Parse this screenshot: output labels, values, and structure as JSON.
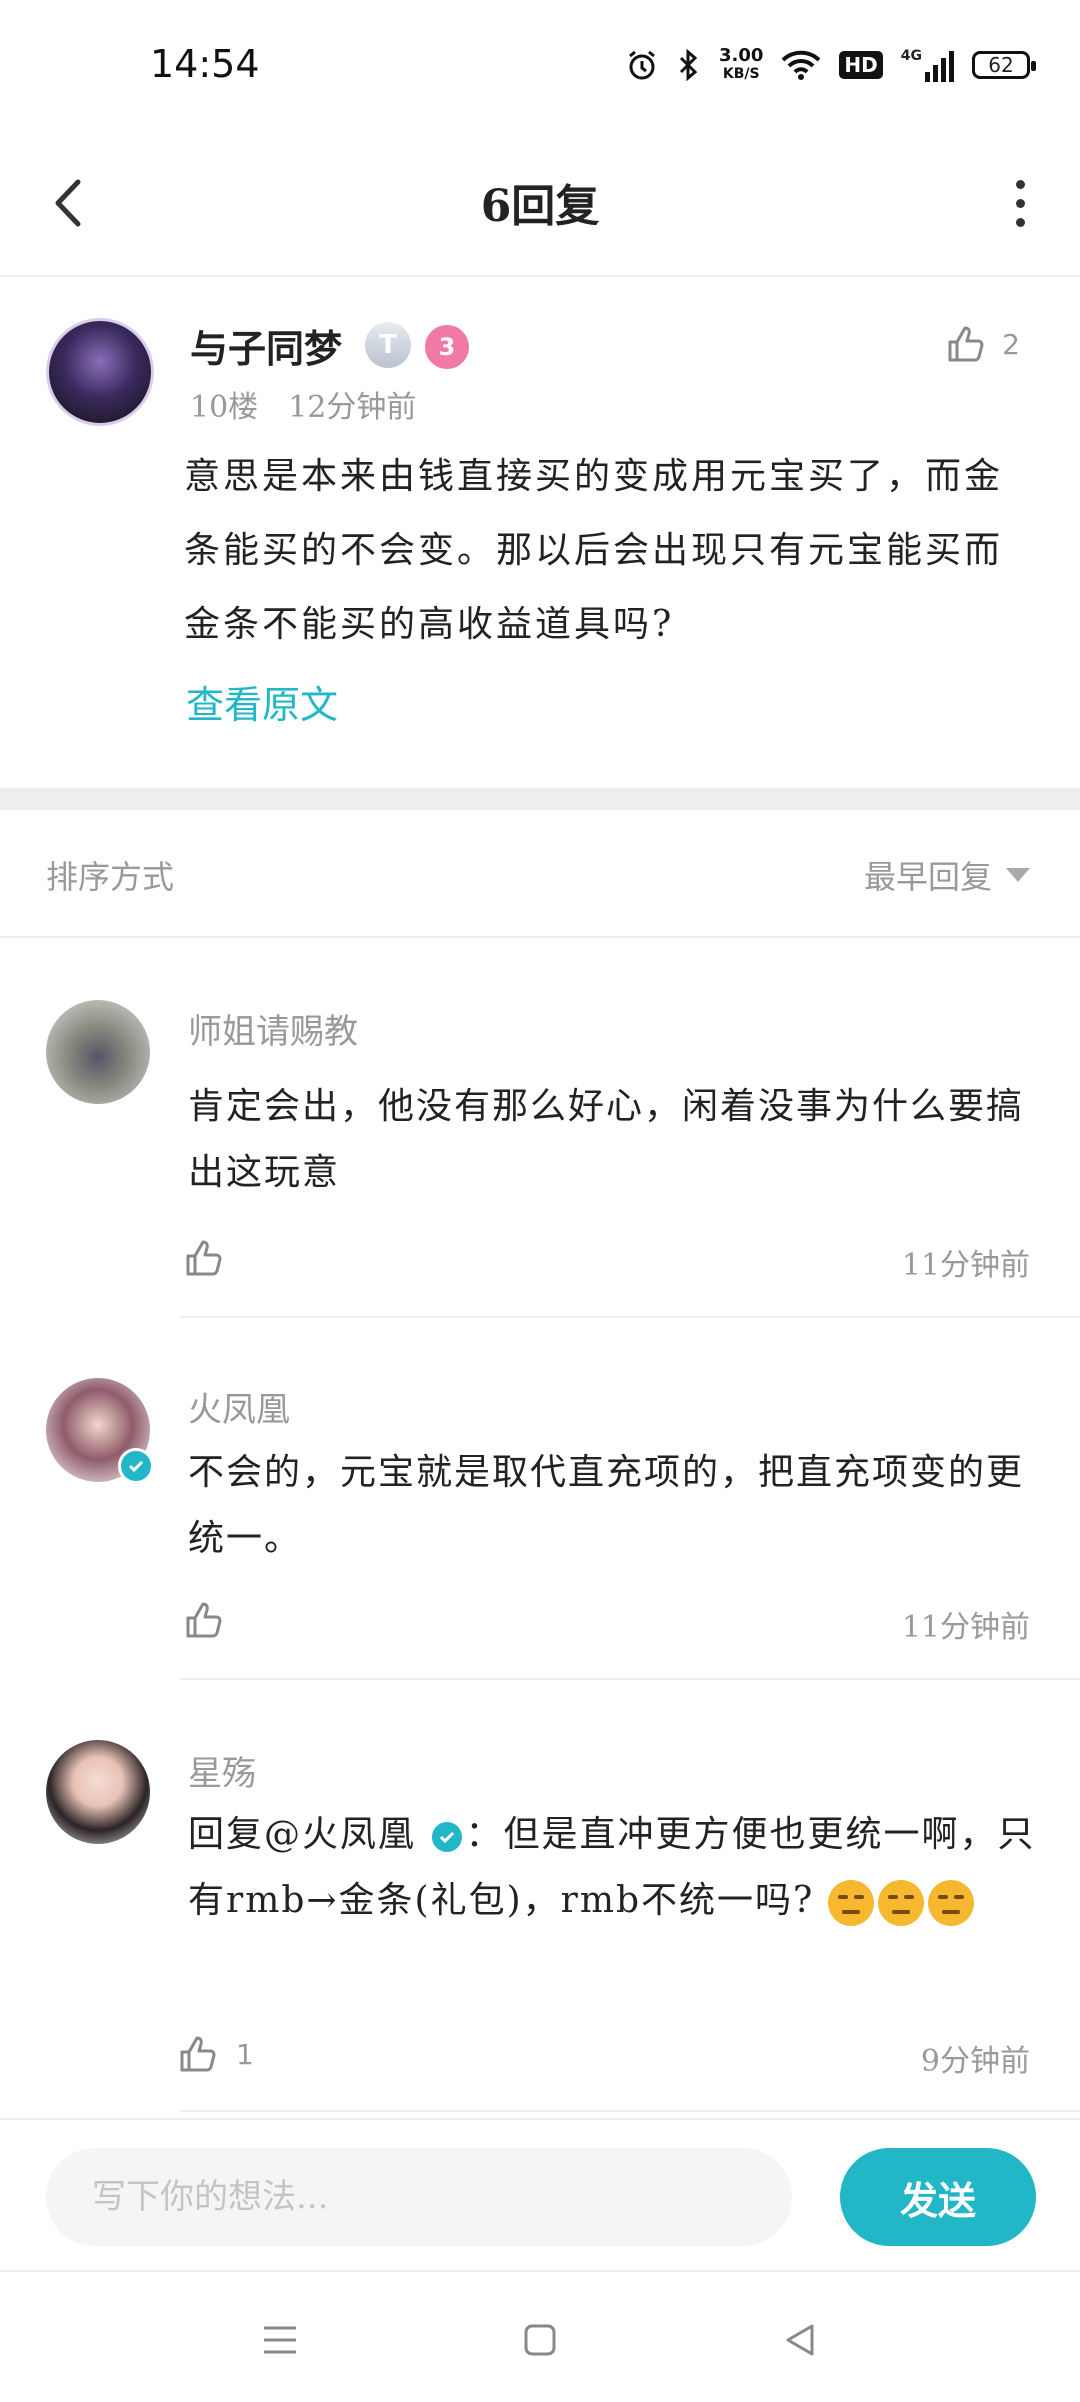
{
  "status_bar": {
    "time": "14:54",
    "speed_value": "3.00",
    "speed_unit": "KB/S",
    "hd": "HD",
    "network": "4G",
    "battery": "62"
  },
  "header": {
    "title": "6回复"
  },
  "post": {
    "username": "与子同梦",
    "badge_t": "T",
    "badge_level": "3",
    "floor": "10楼",
    "time": "12分钟前",
    "likes": "2",
    "text": "意思是本来由钱直接买的变成用元宝买了，而金条能买的不会变。那以后会出现只有元宝能买而金条不能买的高收益道具吗?",
    "view_original": "查看原文"
  },
  "sort": {
    "label": "排序方式",
    "selected": "最早回复"
  },
  "replies": [
    {
      "username": "师姐请赐教",
      "text": "肯定会出，他没有那么好心，闲着没事为什么要搞出这玩意",
      "time": "11分钟前",
      "likes": ""
    },
    {
      "username": "火凤凰",
      "text": "不会的，元宝就是取代直充项的，把直充项变的更统一。",
      "time": "11分钟前",
      "likes": ""
    },
    {
      "username": "星殇",
      "reply_prefix": "回复",
      "mention": "@火凤凰",
      "text_after_mention": "：但是直冲更方便也更统一啊，只有rmb→金条(礼包)，rmb不统一吗?",
      "time": "9分钟前",
      "likes": "1"
    }
  ],
  "input": {
    "placeholder": "写下你的想法...",
    "send_label": "发送"
  },
  "colors": {
    "accent": "#21b7c7",
    "text_primary": "#222222",
    "text_secondary": "#999999"
  }
}
